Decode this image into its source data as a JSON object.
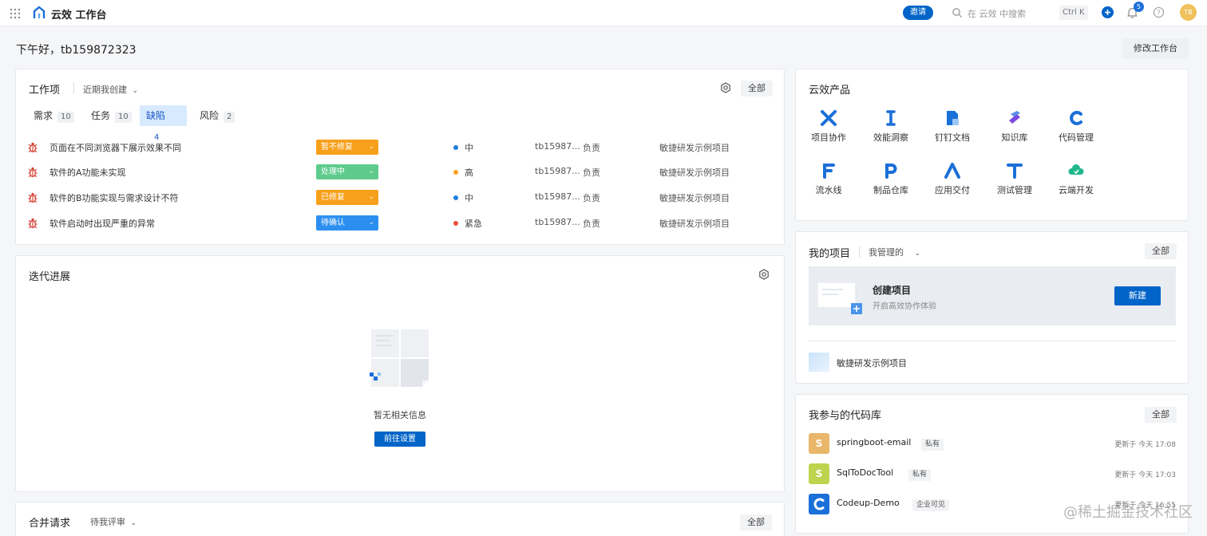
{
  "header": {
    "app_title": "云效 工作台",
    "invite_label": "邀请",
    "search_placeholder": "在 云效 中搜索",
    "shortcut": "Ctrl K",
    "notification_count": "5",
    "avatar_initials": "TB"
  },
  "greeting": "下午好，tb159872323",
  "edit_workspace_label": "修改工作台",
  "workitems": {
    "title": "工作项",
    "filter_label": "近期我创建",
    "all_label": "全部",
    "tabs": [
      {
        "label": "需求",
        "count": "10"
      },
      {
        "label": "任务",
        "count": "10"
      },
      {
        "label": "缺陷",
        "count": "4"
      },
      {
        "label": "风险",
        "count": "2"
      }
    ],
    "active_tab_index": 2,
    "rows": [
      {
        "title": "页面在不同浏览器下展示效果不同",
        "status": "暂不修复",
        "status_color": "#f7a01c",
        "priority": "中",
        "priority_color": "#1b7fd8",
        "user": "tb15987...",
        "role": "负责",
        "project": "敏捷研发示例项目"
      },
      {
        "title": "软件的A功能未实现",
        "status": "处理中",
        "status_color": "#5ecb8c",
        "priority": "高",
        "priority_color": "#f7a01c",
        "user": "tb15987...",
        "role": "负责",
        "project": "敏捷研发示例项目"
      },
      {
        "title": "软件的B功能实现与需求设计不符",
        "status": "已修复",
        "status_color": "#f7a01c",
        "priority": "中",
        "priority_color": "#1b7fd8",
        "user": "tb15987...",
        "role": "负责",
        "project": "敏捷研发示例项目"
      },
      {
        "title": "软件启动时出现严重的异常",
        "status": "待确认",
        "status_color": "#2c8ff0",
        "priority": "紧急",
        "priority_color": "#e8503a",
        "user": "tb15987...",
        "role": "负责",
        "project": "敏捷研发示例项目"
      }
    ]
  },
  "iteration": {
    "title": "迭代进展",
    "empty_text": "暂无相关信息",
    "goto_settings_label": "前往设置"
  },
  "merge_requests": {
    "title": "合并请求",
    "filter_label": "待我评审",
    "all_label": "全部"
  },
  "products": {
    "title": "云效产品",
    "items": [
      {
        "label": "项目协作",
        "icon": "project-collab-icon",
        "color": "#1b6fd8"
      },
      {
        "label": "效能洞察",
        "icon": "insight-icon",
        "color": "#1b6fd8"
      },
      {
        "label": "钉钉文档",
        "icon": "dingtalk-doc-icon",
        "color": "#1b6fd8"
      },
      {
        "label": "知识库",
        "icon": "knowledge-icon",
        "color": "#7a4ce0"
      },
      {
        "label": "代码管理",
        "icon": "code-icon",
        "color": "#1b6fd8"
      },
      {
        "label": "流水线",
        "icon": "pipeline-icon",
        "color": "#1b6fd8"
      },
      {
        "label": "制品仓库",
        "icon": "artifact-icon",
        "color": "#1b6fd8"
      },
      {
        "label": "应用交付",
        "icon": "delivery-icon",
        "color": "#1b6fd8"
      },
      {
        "label": "测试管理",
        "icon": "testing-icon",
        "color": "#1b6fd8"
      },
      {
        "label": "云端开发",
        "icon": "cloud-dev-icon",
        "color": "#1fb88b"
      }
    ]
  },
  "my_projects": {
    "title": "我的项目",
    "filter_label": "我管理的",
    "all_label": "全部",
    "create_title": "创建项目",
    "create_subtitle": "开启高效协作体验",
    "new_label": "新建",
    "project_name": "敏捷研发示例项目"
  },
  "repos": {
    "title": "我参与的代码库",
    "all_label": "全部",
    "items": [
      {
        "avatar": "S",
        "avatar_color": "#e9b66a",
        "name": "springboot-email",
        "visibility": "私有",
        "updated": "更新于 今天 17:08"
      },
      {
        "avatar": "S",
        "avatar_color": "#bfd34f",
        "name": "SqlToDocTool",
        "visibility": "私有",
        "updated": "更新于 今天 17:03"
      },
      {
        "avatar": "C",
        "avatar_color": "#1b6fd8",
        "name": "Codeup-Demo",
        "visibility": "企业可见",
        "updated": "更新于 今天 16:55"
      }
    ]
  },
  "watermark": "@稀土掘金技术社区",
  "colors": {
    "accent": "#0064c8",
    "bug_red": "#d9473a"
  }
}
